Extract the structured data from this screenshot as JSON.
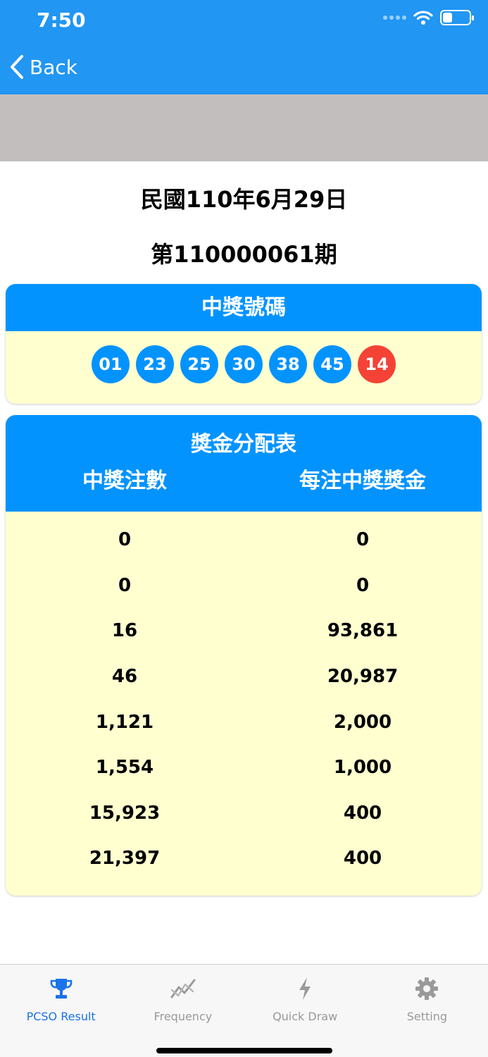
{
  "status_bar": {
    "time": "7:50",
    "battery_level": 0.35
  },
  "nav": {
    "back_label": "Back"
  },
  "draw": {
    "date": "民國110年6月29日",
    "number": "第110000061期"
  },
  "winning": {
    "title": "中獎號碼",
    "numbers": [
      "01",
      "23",
      "25",
      "30",
      "38",
      "45"
    ],
    "special": "14",
    "colors": {
      "regular": "#0393ff",
      "special": "#f44336"
    }
  },
  "prize_table": {
    "title": "獎金分配表",
    "col_winners": "中獎注數",
    "col_amount": "每注中獎獎金",
    "rows": [
      {
        "winners": "0",
        "amount": "0"
      },
      {
        "winners": "0",
        "amount": "0"
      },
      {
        "winners": "16",
        "amount": "93,861"
      },
      {
        "winners": "46",
        "amount": "20,987"
      },
      {
        "winners": "1,121",
        "amount": "2,000"
      },
      {
        "winners": "1,554",
        "amount": "1,000"
      },
      {
        "winners": "15,923",
        "amount": "400"
      },
      {
        "winners": "21,397",
        "amount": "400"
      }
    ]
  },
  "tabs": [
    {
      "label": "PCSO Result",
      "icon": "trophy-icon",
      "active": true
    },
    {
      "label": "Frequency",
      "icon": "chart-line-icon",
      "active": false
    },
    {
      "label": "Quick Draw",
      "icon": "bolt-icon",
      "active": false
    },
    {
      "label": "Setting",
      "icon": "gear-icon",
      "active": false
    }
  ],
  "theme": {
    "primary": "#2196f3",
    "card_bg": "#ffffcf",
    "active_tab": "#1a73e8"
  }
}
